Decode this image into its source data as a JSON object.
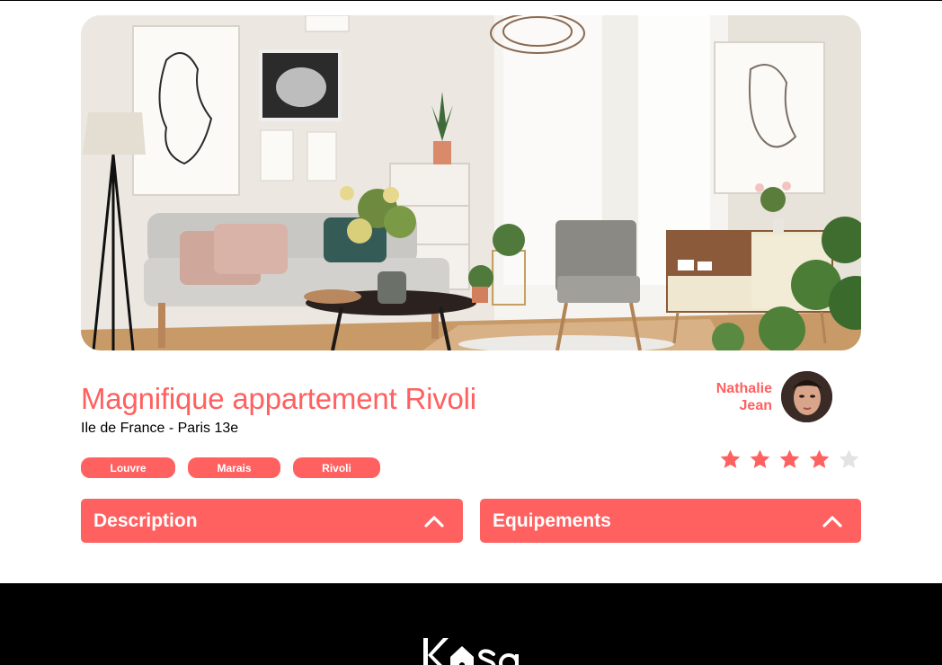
{
  "listing": {
    "title": "Magnifique appartement Rivoli",
    "location": "Ile de France - Paris 13e",
    "tags": [
      "Louvre",
      "Marais",
      "Rivoli"
    ],
    "rating": 4,
    "rating_max": 5
  },
  "host": {
    "first_name": "Nathalie",
    "last_name": "Jean"
  },
  "collapses": [
    {
      "label": "Description",
      "icon": "chevron-up-icon"
    },
    {
      "label": "Equipements",
      "icon": "chevron-up-icon"
    }
  ],
  "colors": {
    "accent": "#FF6060",
    "star_inactive": "#E3E3E3",
    "footer": "#000000"
  },
  "footer": {
    "logo_alt": "Kasa"
  }
}
